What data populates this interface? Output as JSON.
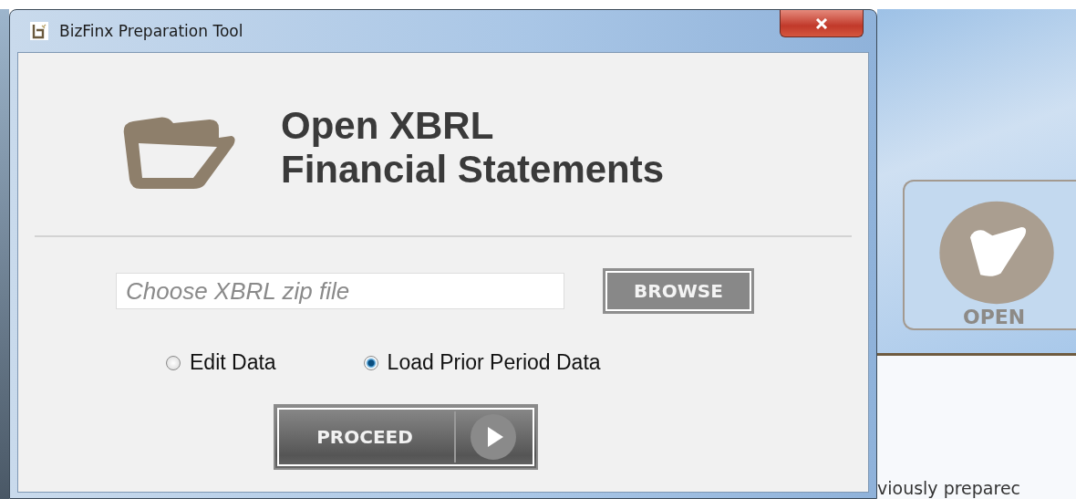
{
  "window": {
    "title": "BizFinx Preparation Tool"
  },
  "heading": [
    "Open XBRL",
    "Financial Statements"
  ],
  "file_field": {
    "placeholder": "Choose XBRL zip file"
  },
  "browse_button": "BROWSE",
  "modes": [
    {
      "label": "Edit Data",
      "selected": false
    },
    {
      "label": "Load Prior Period Data",
      "selected": true
    }
  ],
  "proceed_button": "PROCEED",
  "background_app": {
    "open_tile": "OPEN",
    "text_fragment": "viously preparec"
  }
}
